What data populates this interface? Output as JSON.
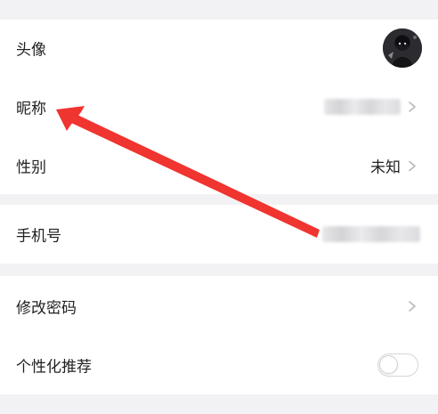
{
  "profile": {
    "avatar_label": "头像",
    "nickname_label": "昵称",
    "gender_label": "性别",
    "gender_value": "未知"
  },
  "account": {
    "phone_label": "手机号"
  },
  "settings": {
    "change_password_label": "修改密码",
    "personalized_recommendation_label": "个性化推荐",
    "personalized_recommendation_enabled": false
  },
  "annotation": {
    "arrow_color": "#f0342f"
  },
  "colors": {
    "page_background": "#f2f2f4",
    "card_background": "#ffffff",
    "text_primary": "#222222",
    "chevron": "#b8b8bc"
  }
}
